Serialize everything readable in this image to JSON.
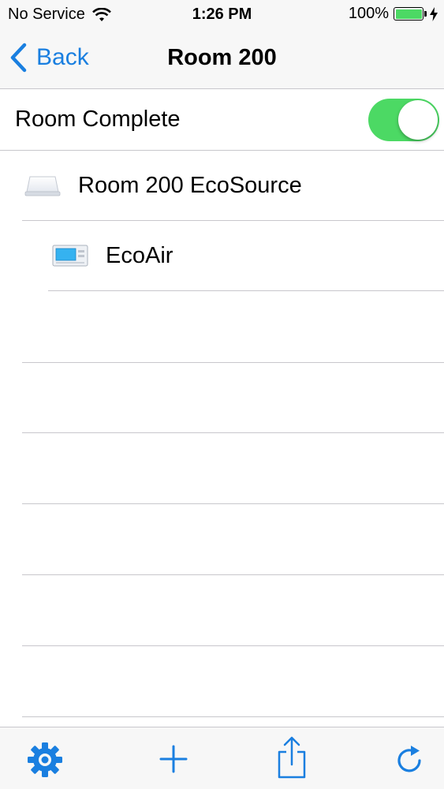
{
  "status_bar": {
    "carrier": "No Service",
    "time": "1:26 PM",
    "battery_percent": "100%",
    "battery_level": 1.0
  },
  "nav": {
    "back_label": "Back",
    "title": "Room 200"
  },
  "room_complete": {
    "label": "Room Complete",
    "toggle_on": true
  },
  "devices": [
    {
      "label": "Room 200 EcoSource",
      "icon": "ecosource-device-icon",
      "level": 0
    },
    {
      "label": "EcoAir",
      "icon": "ecoair-thermostat-icon",
      "level": 1
    }
  ],
  "toolbar": {
    "items": [
      "gear-icon",
      "add-icon",
      "share-icon",
      "refresh-icon"
    ]
  },
  "colors": {
    "accent": "#1a7fe0",
    "toggle_on": "#4cd964",
    "separator": "#c8c7cc",
    "bar_background": "#f7f7f7"
  }
}
